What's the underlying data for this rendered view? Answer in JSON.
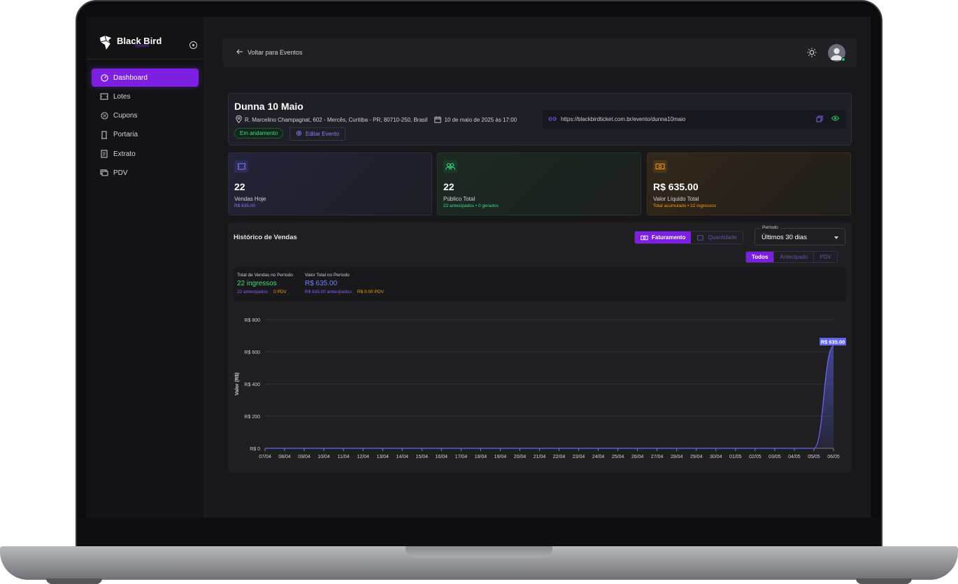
{
  "brand": {
    "name": "Black Bird",
    "sub": "System"
  },
  "sidebar": {
    "items": [
      {
        "label": "Dashboard",
        "icon": "dashboard-icon",
        "active": true
      },
      {
        "label": "Lotes",
        "icon": "ticket-icon"
      },
      {
        "label": "Cupons",
        "icon": "coupon-icon"
      },
      {
        "label": "Portaria",
        "icon": "door-icon"
      },
      {
        "label": "Extrato",
        "icon": "receipt-icon"
      },
      {
        "label": "PDV",
        "icon": "pos-icon"
      }
    ]
  },
  "topbar": {
    "back_label": "Voltar para Eventos"
  },
  "event": {
    "title": "Dunna 10 Maio",
    "address": "R. Marcelino Champagnat, 602 - Mercês, Curitiba - PR, 80710-250, Brasil",
    "date": "10 de maio de 2025 às 17:00",
    "status": "Em andamento",
    "edit_label": "Editar Evento",
    "url": "https://blackbirdticket.com.br/evento/dunna10maio"
  },
  "stats": {
    "sales_today": {
      "value": "22",
      "label": "Vendas Hoje",
      "sub": "R$ 635.00"
    },
    "audience": {
      "value": "22",
      "label": "Público Total",
      "sub": "22 antecipados • 0 gerados"
    },
    "net_value": {
      "value": "R$ 635.00",
      "label": "Valor Líquido Total",
      "sub": "Total acumulado • 22 ingressos"
    }
  },
  "history": {
    "title": "Histórico de Vendas",
    "toggle": {
      "revenue": "Faturamento",
      "quantity": "Quantidade"
    },
    "period_label": "Período",
    "period_value": "Últimos 30 dias",
    "filters": [
      "Todos",
      "Antecipado",
      "PDV"
    ],
    "totals": {
      "sales_label": "Total de Vendas no Período",
      "sales_value": "22 ingressos",
      "sales_advance": "22 antecipados",
      "sales_pos": "0 PDV",
      "value_label": "Valor Total no Período",
      "value_value": "R$ 635.00",
      "value_advance": "R$ 635.00 antecipados",
      "value_pos": "R$ 0.00 PDV"
    }
  },
  "colors": {
    "accent": "#7c1fe0",
    "green": "#3ddc84",
    "orange": "#f59e0b",
    "line": "#6366f1"
  },
  "chart_data": {
    "type": "area",
    "title": "",
    "xlabel": "",
    "ylabel": "Valor (R$)",
    "ylim": [
      0,
      800
    ],
    "yticks": [
      "R$ 0",
      "R$ 200",
      "R$ 400",
      "R$ 600",
      "R$ 800"
    ],
    "categories": [
      "07/04",
      "08/04",
      "09/04",
      "10/04",
      "11/04",
      "12/04",
      "13/04",
      "14/04",
      "15/04",
      "16/04",
      "17/04",
      "18/04",
      "19/04",
      "20/04",
      "21/04",
      "22/04",
      "23/04",
      "24/04",
      "25/04",
      "26/04",
      "27/04",
      "28/04",
      "29/04",
      "30/04",
      "01/05",
      "02/05",
      "03/05",
      "04/05",
      "05/05",
      "06/05"
    ],
    "values": [
      0,
      0,
      0,
      0,
      0,
      0,
      0,
      0,
      0,
      0,
      0,
      0,
      0,
      0,
      0,
      0,
      0,
      0,
      0,
      0,
      0,
      0,
      0,
      0,
      0,
      0,
      0,
      0,
      0,
      635
    ],
    "peak_label": "R$ 635.00"
  }
}
